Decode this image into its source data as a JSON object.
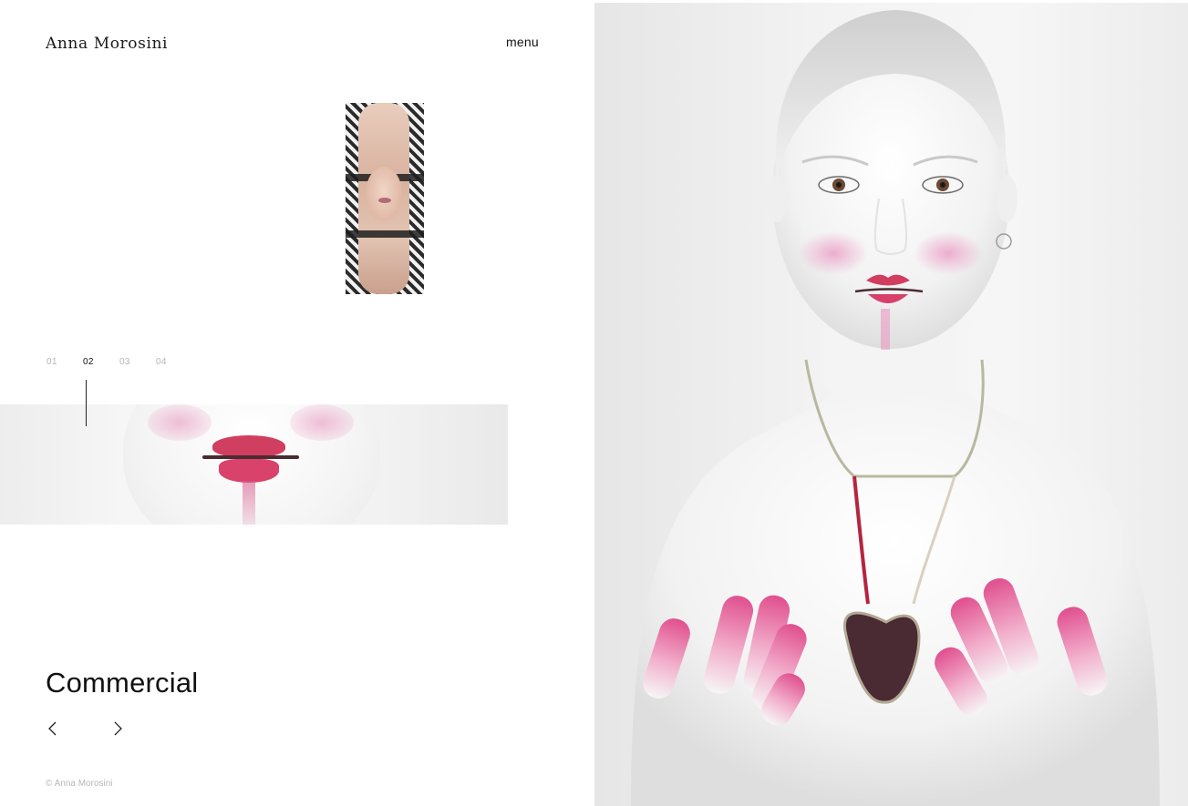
{
  "site": {
    "name": "Anna Morosini"
  },
  "nav": {
    "menu_label": "menu"
  },
  "gallery": {
    "category_title": "Commercial",
    "slides": [
      "01",
      "02",
      "03",
      "04"
    ],
    "active_slide": "02",
    "prev_icon": "chevron-left-icon",
    "next_icon": "chevron-right-icon"
  },
  "footer": {
    "copyright": "© Anna Morosini"
  },
  "colors": {
    "text": "#111111",
    "muted": "#b5b5b5",
    "background": "#ffffff",
    "accent_lips": "#d03f5f"
  }
}
